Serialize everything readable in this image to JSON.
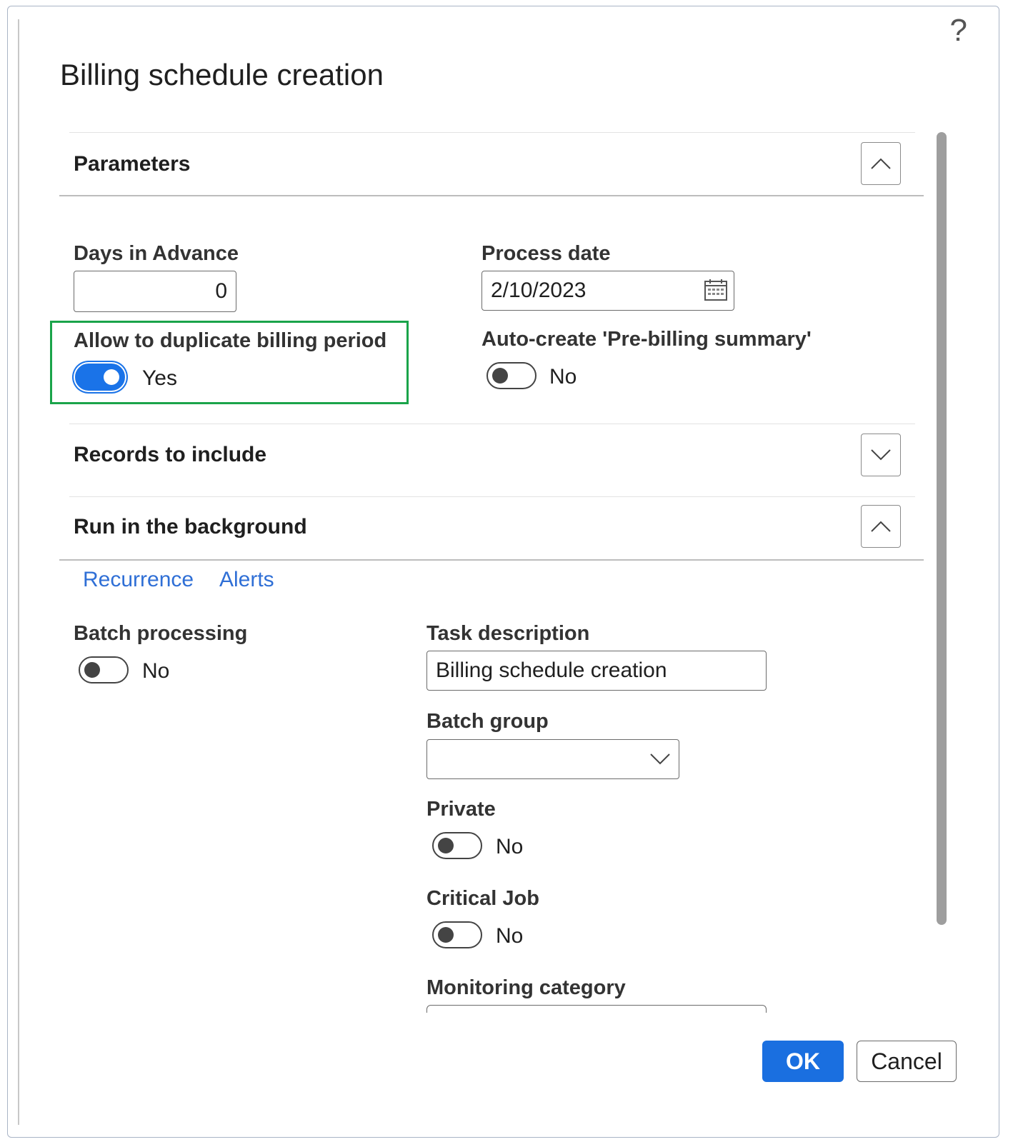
{
  "dialog": {
    "title": "Billing schedule creation",
    "help_symbol": "?"
  },
  "parameters": {
    "section_title": "Parameters",
    "days_in_advance": {
      "label": "Days in Advance",
      "value": "0"
    },
    "process_date": {
      "label": "Process date",
      "value": "2/10/2023"
    },
    "allow_duplicate": {
      "label": "Allow to duplicate billing period",
      "state": "on",
      "value_label": "Yes"
    },
    "auto_create": {
      "label": "Auto-create 'Pre-billing summary'",
      "state": "off",
      "value_label": "No"
    }
  },
  "records_to_include": {
    "section_title": "Records to include"
  },
  "run_in_background": {
    "section_title": "Run in the background",
    "links": [
      "Recurrence",
      "Alerts"
    ],
    "batch_processing": {
      "label": "Batch processing",
      "state": "off",
      "value_label": "No"
    },
    "task_description": {
      "label": "Task description",
      "value": "Billing schedule creation"
    },
    "batch_group": {
      "label": "Batch group",
      "value": ""
    },
    "private": {
      "label": "Private",
      "state": "off",
      "value_label": "No"
    },
    "critical_job": {
      "label": "Critical Job",
      "state": "off",
      "value_label": "No"
    },
    "monitoring_category": {
      "label": "Monitoring category"
    }
  },
  "footer": {
    "ok_label": "OK",
    "cancel_label": "Cancel"
  },
  "colors": {
    "accent": "#1a73e8",
    "highlight_border": "#1aa44a",
    "link": "#2f6fd6"
  }
}
